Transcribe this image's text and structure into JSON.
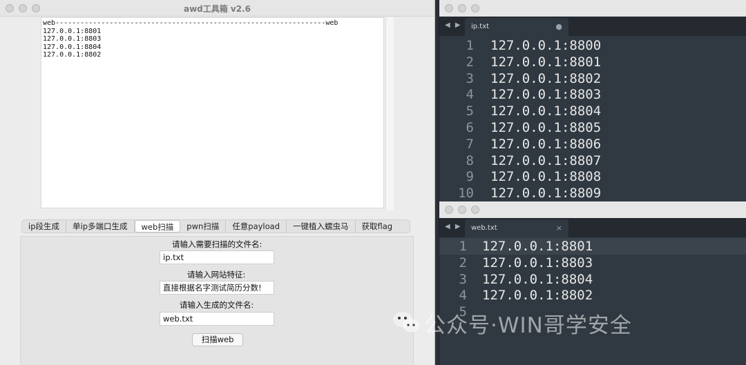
{
  "left_window": {
    "title": "awd工具箱 v2.6",
    "output_lines": [
      "web-----------------------------------------------------------------web",
      "127.0.0.1:8801",
      "127.0.0.1:8803",
      "127.0.0.1:8804",
      "127.0.0.1:8802"
    ],
    "tabs": [
      {
        "label": "ip段生成",
        "active": false
      },
      {
        "label": "单ip多端口生成",
        "active": false
      },
      {
        "label": "web扫描",
        "active": true
      },
      {
        "label": "pwn扫描",
        "active": false
      },
      {
        "label": "任意payload",
        "active": false
      },
      {
        "label": "一键植入蠕虫马",
        "active": false
      },
      {
        "label": "获取flag",
        "active": false
      }
    ],
    "form": {
      "label_scan_file": "请输入需要扫描的文件名:",
      "scan_file_value": "ip.txt",
      "label_site_feature": "请输入网站特征:",
      "site_feature_value": "直接根据名字测试简历分数!",
      "label_output_file": "请输入生成的文件名:",
      "output_file_value": "web.txt",
      "scan_button": "扫描web"
    }
  },
  "editor_top": {
    "tab_name": "ip.txt",
    "tab_mark": "●",
    "lines": [
      {
        "n": "1",
        "text": "127.0.0.1:8800"
      },
      {
        "n": "2",
        "text": "127.0.0.1:8801"
      },
      {
        "n": "3",
        "text": "127.0.0.1:8802"
      },
      {
        "n": "4",
        "text": "127.0.0.1:8803"
      },
      {
        "n": "5",
        "text": "127.0.0.1:8804"
      },
      {
        "n": "6",
        "text": "127.0.0.1:8805"
      },
      {
        "n": "7",
        "text": "127.0.0.1:8806"
      },
      {
        "n": "8",
        "text": "127.0.0.1:8807"
      },
      {
        "n": "9",
        "text": "127.0.0.1:8808"
      },
      {
        "n": "10",
        "text": "127.0.0.1:8809"
      }
    ]
  },
  "editor_bottom": {
    "tab_name": "web.txt",
    "tab_mark": "×",
    "lines": [
      {
        "n": "1",
        "text": "127.0.0.1:8801"
      },
      {
        "n": "2",
        "text": "127.0.0.1:8803"
      },
      {
        "n": "3",
        "text": "127.0.0.1:8804"
      },
      {
        "n": "4",
        "text": "127.0.0.1:8802"
      },
      {
        "n": "5",
        "text": ""
      }
    ]
  },
  "watermark": "公众号·WIN哥学安全",
  "colors": {
    "editor_bg": "#303841",
    "tab_strip": "#252a31",
    "line_number": "#8d949d"
  }
}
